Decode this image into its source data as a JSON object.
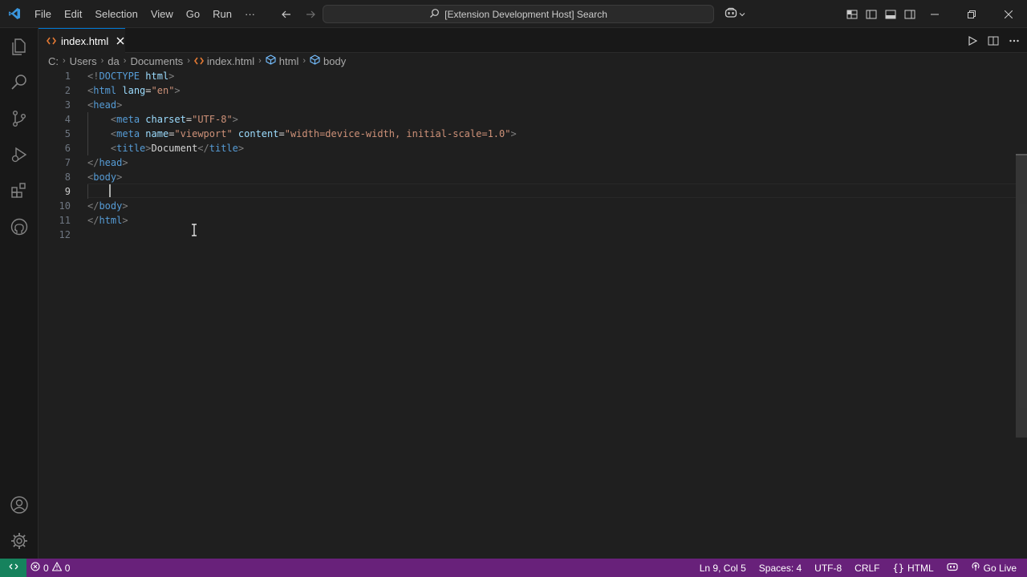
{
  "titlebar": {
    "menu": [
      "File",
      "Edit",
      "Selection",
      "View",
      "Go",
      "Run"
    ],
    "more_label": "···",
    "command_center": "[Extension Development Host] Search"
  },
  "activity_bar": {
    "items": [
      "explorer-icon",
      "search-icon",
      "source-control-icon",
      "run-debug-icon",
      "extensions-icon",
      "github-icon"
    ],
    "bottom": [
      "account-icon",
      "manage-gear-icon"
    ]
  },
  "tabs": [
    {
      "label": "index.html",
      "active": true
    }
  ],
  "breadcrumbs": [
    "C:",
    "Users",
    "da",
    "Documents",
    "index.html",
    "html",
    "body"
  ],
  "editor": {
    "active_line": 9,
    "line_numbers": [
      "1",
      "2",
      "3",
      "4",
      "5",
      "6",
      "7",
      "8",
      "9",
      "10",
      "11",
      "12"
    ],
    "lines": [
      [
        [
          "<!",
          "punc"
        ],
        [
          "DOCTYPE",
          "tag"
        ],
        [
          " ",
          "text"
        ],
        [
          "html",
          "attr"
        ],
        [
          ">",
          "punc"
        ]
      ],
      [
        [
          "<",
          "punc"
        ],
        [
          "html",
          "tag"
        ],
        [
          " ",
          "text"
        ],
        [
          "lang",
          "attr"
        ],
        [
          "=",
          "text"
        ],
        [
          "\"en\"",
          "str"
        ],
        [
          ">",
          "punc"
        ]
      ],
      [
        [
          "<",
          "punc"
        ],
        [
          "head",
          "tag"
        ],
        [
          ">",
          "punc"
        ]
      ],
      [
        [
          "    ",
          "text"
        ],
        [
          "<",
          "punc"
        ],
        [
          "meta",
          "tag"
        ],
        [
          " ",
          "text"
        ],
        [
          "charset",
          "attr"
        ],
        [
          "=",
          "text"
        ],
        [
          "\"UTF-8\"",
          "str"
        ],
        [
          ">",
          "punc"
        ]
      ],
      [
        [
          "    ",
          "text"
        ],
        [
          "<",
          "punc"
        ],
        [
          "meta",
          "tag"
        ],
        [
          " ",
          "text"
        ],
        [
          "name",
          "attr"
        ],
        [
          "=",
          "text"
        ],
        [
          "\"viewport\"",
          "str"
        ],
        [
          " ",
          "text"
        ],
        [
          "content",
          "attr"
        ],
        [
          "=",
          "text"
        ],
        [
          "\"width=device-width, initial-scale=1.0\"",
          "str"
        ],
        [
          ">",
          "punc"
        ]
      ],
      [
        [
          "    ",
          "text"
        ],
        [
          "<",
          "punc"
        ],
        [
          "title",
          "tag"
        ],
        [
          ">",
          "punc"
        ],
        [
          "Document",
          "text"
        ],
        [
          "</",
          "punc"
        ],
        [
          "title",
          "tag"
        ],
        [
          ">",
          "punc"
        ]
      ],
      [
        [
          "</",
          "punc"
        ],
        [
          "head",
          "tag"
        ],
        [
          ">",
          "punc"
        ]
      ],
      [
        [
          "<",
          "punc"
        ],
        [
          "body",
          "tag"
        ],
        [
          ">",
          "punc"
        ]
      ],
      [
        [
          "    ",
          "text"
        ]
      ],
      [
        [
          "</",
          "punc"
        ],
        [
          "body",
          "tag"
        ],
        [
          ">",
          "punc"
        ]
      ],
      [
        [
          "</",
          "punc"
        ],
        [
          "html",
          "tag"
        ],
        [
          ">",
          "punc"
        ]
      ],
      []
    ]
  },
  "statusbar": {
    "errors": "0",
    "warnings": "0",
    "position": "Ln 9, Col 5",
    "spaces": "Spaces: 4",
    "encoding": "UTF-8",
    "eol": "CRLF",
    "language": "HTML",
    "golive": "Go Live"
  },
  "colors": {
    "accent": "#0078d4",
    "statusbar": "#68217a",
    "remote": "#16825d"
  }
}
